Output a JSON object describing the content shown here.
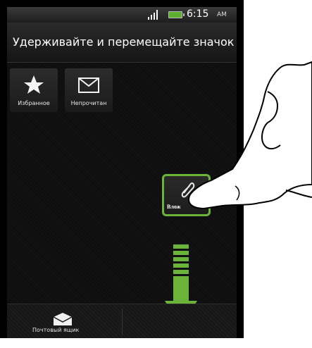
{
  "status_bar": {
    "time": "6:15",
    "ampm": "AM",
    "icons": [
      "signal-icon",
      "battery-icon"
    ]
  },
  "header": {
    "title": "Удерживайте и перемещайте значок"
  },
  "tiles": [
    {
      "label": "Избранное",
      "icon": "star-icon"
    },
    {
      "label": "Непрочитан",
      "icon": "envelope-icon"
    }
  ],
  "dragged_tile": {
    "label": "Влож",
    "icon": "paperclip-icon"
  },
  "bottom_bar": {
    "tab_label": "Почтовый ящик",
    "tab_icon": "mailbox-icon"
  },
  "colors": {
    "accent": "#6bb43a",
    "battery": "#5bb030",
    "background": "#000000"
  }
}
